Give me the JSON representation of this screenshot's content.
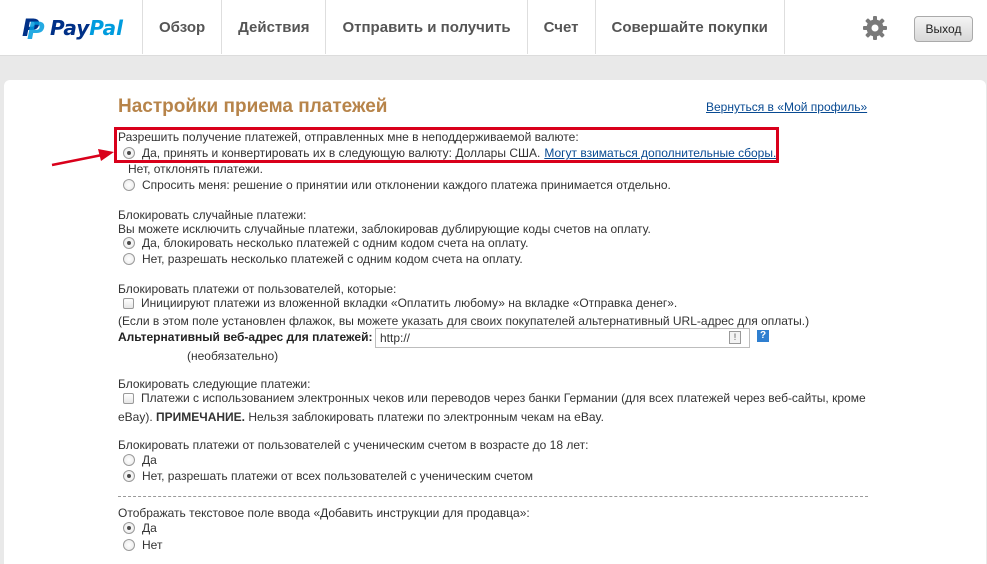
{
  "header": {
    "brand": {
      "pay": "Pay",
      "pal": "Pal"
    },
    "nav": [
      "Обзор",
      "Действия",
      "Отправить и получить",
      "Счет",
      "Совершайте покупки"
    ],
    "logout_label": "Выход"
  },
  "page": {
    "title": "Настройки приема платежей",
    "back_link": "Вернуться в «Мой профиль»"
  },
  "currency": {
    "question": "Разрешить получение платежей, отправленных мне в неподдерживаемой валюте:",
    "options": [
      {
        "label": "Да, принять и конвертировать их в следующую валюту: Доллары США.",
        "link": "Могут взиматься дополнительные сборы.",
        "selected": true
      },
      {
        "label": "Нет, отклонять платежи.",
        "selected": false
      },
      {
        "label": "Спросить меня: решение о принятии или отклонении каждого платежа принимается отдельно.",
        "selected": false
      }
    ]
  },
  "duplicates": {
    "question": "Блокировать случайные платежи:",
    "description": "Вы можете исключить случайные платежи, заблокировав дублирующие коды счетов на оплату.",
    "options": [
      {
        "label": "Да, блокировать несколько платежей с одним кодом счета на оплату.",
        "selected": true
      },
      {
        "label": "Нет, разрешать несколько платежей с одним кодом счета на оплату.",
        "selected": false
      }
    ]
  },
  "users": {
    "question": "Блокировать платежи от пользователей, которые:",
    "checkbox_label": "Инициируют платежи из вложенной вкладки «Оплатить любому» на вкладке «Отправка денег».",
    "note": "(Если в этом поле установлен флажок, вы можете указать для своих покупателей альтернативный URL-адрес для оплаты.)",
    "url_label": "Альтернативный веб-адрес для платежей:",
    "url_value": "http://",
    "optional": "(необязательно)",
    "help": "?"
  },
  "echeck": {
    "question": "Блокировать следующие платежи:",
    "checkbox_label": "Платежи с использованием электронных чеков или переводов через банки Германии (для всех платежей через веб-сайты, кроме",
    "continuation": "eBay).",
    "note_bold": "ПРИМЕЧАНИЕ.",
    "note": "Нельзя заблокировать платежи по электронным чекам на eBay."
  },
  "student": {
    "question": "Блокировать платежи от пользователей с ученическим счетом в возрасте до 18 лет:",
    "options": [
      {
        "label": "Да",
        "selected": false
      },
      {
        "label": "Нет, разрешать платежи от всех пользователей с ученическим счетом",
        "selected": true
      }
    ]
  },
  "instructions": {
    "question": "Отображать текстовое поле ввода «Добавить инструкции для продавца»:",
    "options": [
      {
        "label": "Да",
        "selected": true
      },
      {
        "label": "Нет",
        "selected": false
      }
    ]
  },
  "colors": {
    "highlight": "#d9001b",
    "title": "#b7844a",
    "link": "#084a92",
    "brand_dark": "#003087",
    "brand_light": "#009cde"
  }
}
